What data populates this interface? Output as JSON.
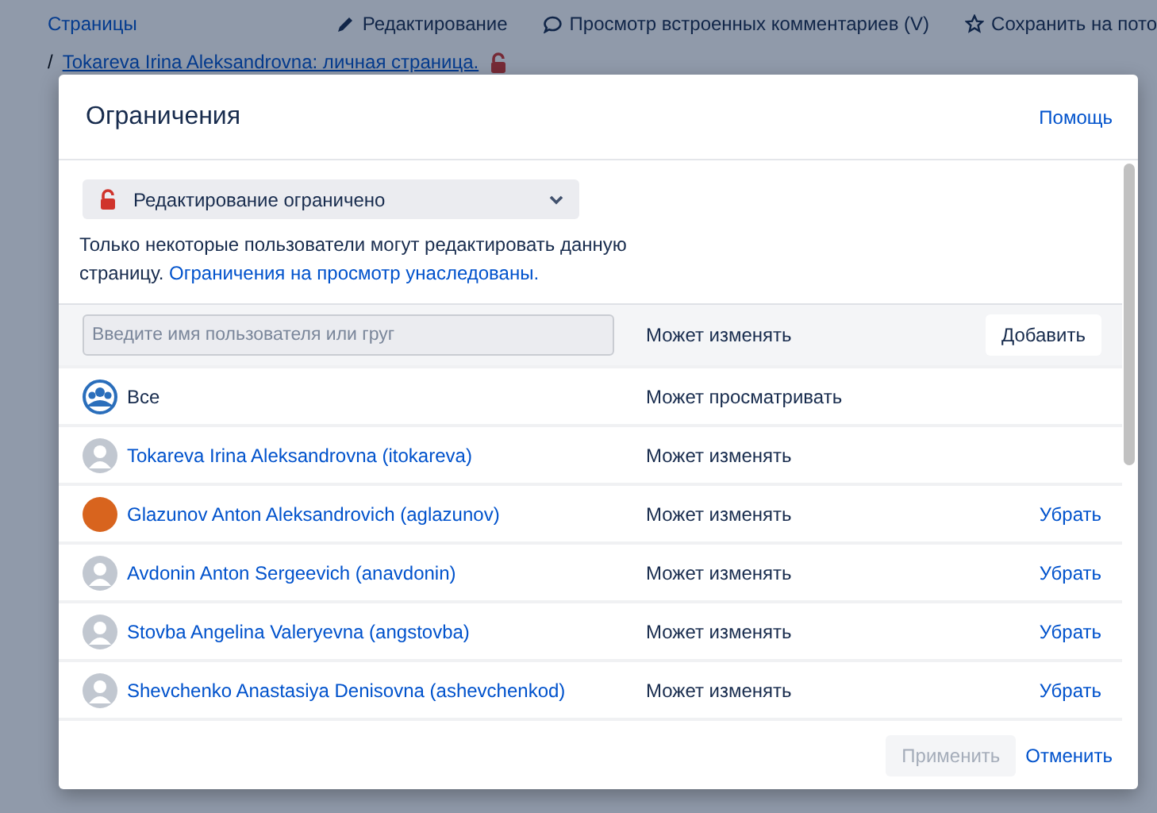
{
  "page": {
    "nav": [
      {
        "kind": "link",
        "label": "Страницы"
      },
      {
        "kind": "edit",
        "label": "Редактирование"
      },
      {
        "kind": "comments",
        "label": "Просмотр встроенных комментариев (V)"
      },
      {
        "kind": "save",
        "label": "Сохранить на пото"
      }
    ],
    "breadcrumb": {
      "separator": "/",
      "label": "Tokareva Irina Aleksandrovna: личная страница."
    }
  },
  "dialog": {
    "title": "Ограничения",
    "help": "Помощь",
    "restriction": {
      "label": "Редактирование ограничено"
    },
    "description": {
      "text": "Только некоторые пользователи могут редактировать данную страницу.",
      "link": "Ограничения на просмотр унаследованы."
    },
    "add_row": {
      "placeholder": "Введите имя пользователя или груг",
      "permission": "Может изменять",
      "button": "Добавить"
    },
    "entries": [
      {
        "kind": "group",
        "name": "Все",
        "permission": "Может просматривать"
      },
      {
        "kind": "default",
        "name": "Tokareva Irina Aleksandrovna (itokareva)",
        "permission": "Может изменять"
      },
      {
        "kind": "photo",
        "name": "Glazunov Anton Aleksandrovich (aglazunov)",
        "permission": "Может изменять",
        "action": "Убрать"
      },
      {
        "kind": "default",
        "name": "Avdonin Anton Sergeevich (anavdonin)",
        "permission": "Может изменять",
        "action": "Убрать"
      },
      {
        "kind": "default",
        "name": "Stovba Angelina Valeryevna (angstovba)",
        "permission": "Может изменять",
        "action": "Убрать"
      },
      {
        "kind": "default",
        "name": "Shevchenko Anastasiya Denisovna (ashevchenkod)",
        "permission": "Может изменять",
        "action": "Убрать"
      }
    ],
    "footer": {
      "apply": {
        "label": "Применить",
        "disabled": true
      },
      "cancel": "Отменить"
    }
  }
}
